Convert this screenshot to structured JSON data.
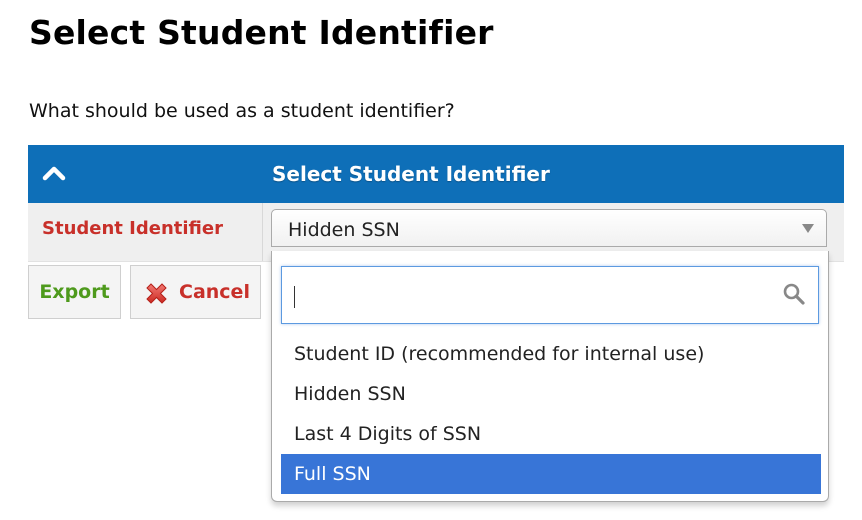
{
  "page": {
    "title": "Select Student Identifier",
    "question": "What should be used as a student identifier?"
  },
  "panel": {
    "header_title": "Select Student Identifier",
    "collapse_icon": "chevron-up-icon",
    "header_color": "#0e6fb8"
  },
  "field": {
    "label": "Student Identifier",
    "label_color": "#c8302a",
    "selected_value": "Hidden SSN"
  },
  "dropdown": {
    "search_value": "",
    "search_icon": "search-icon",
    "options": [
      {
        "label": "Student ID (recommended for internal use)",
        "highlighted": false
      },
      {
        "label": "Hidden SSN",
        "highlighted": false
      },
      {
        "label": "Last 4 Digits of SSN",
        "highlighted": false
      },
      {
        "label": "Full SSN",
        "highlighted": true
      }
    ],
    "highlight_color": "#3875d7"
  },
  "buttons": {
    "export_label": "Export",
    "export_color": "#4e9a1c",
    "cancel_label": "Cancel",
    "cancel_icon": "red-x-icon",
    "cancel_color": "#c8302a"
  }
}
